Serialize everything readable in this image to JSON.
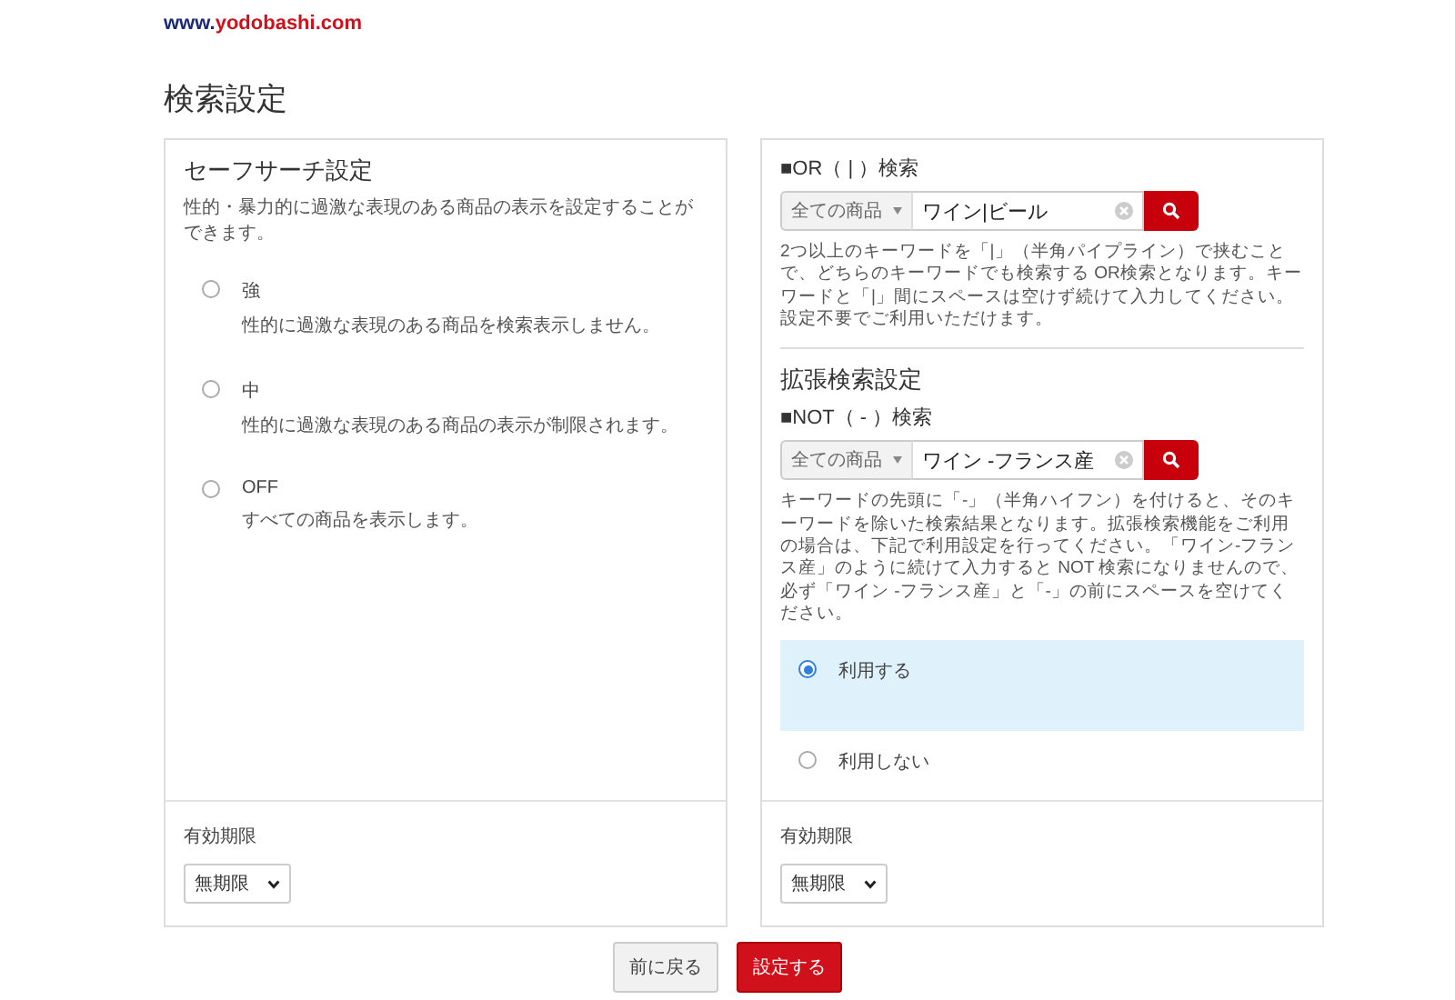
{
  "logo": {
    "prefix": "www.",
    "name": "yodobashi.com"
  },
  "title": "検索設定",
  "safe_search": {
    "heading": "セーフサーチ設定",
    "description": "性的・暴力的に過激な表現のある商品の表示を設定することができます。",
    "options": [
      {
        "label": "強",
        "description": "性的に過激な表現のある商品を検索表示しません。",
        "selected": false
      },
      {
        "label": "中",
        "description": "性的に過激な表現のある商品の表示が制限されます。",
        "selected": false
      },
      {
        "label": "OFF",
        "description": "すべての商品を表示します。",
        "selected": false
      }
    ],
    "expiry": {
      "label": "有効期限",
      "value": "無期限"
    }
  },
  "or_search": {
    "heading": "■OR（ | ）検索",
    "category": "全ての商品",
    "value": "ワイン|ビール",
    "description": "2つ以上のキーワードを「|」（半角パイプライン）で挟むことで、どちらのキーワードでも検索する OR検索となります。キーワードと「|」間にスペースは空けず続けて入力してください。設定不要でご利用いただけます。"
  },
  "extended": {
    "heading": "拡張検索設定",
    "not_heading": "■NOT（ - ）検索",
    "category": "全ての商品",
    "value": "ワイン -フランス産",
    "description": "キーワードの先頭に「-」（半角ハイフン）を付けると、そのキーワードを除いた検索結果となります。拡張検索機能をご利用の場合は、下記で利用設定を行ってください。「ワイン-フランス産」のように続けて入力すると NOT 検索になりませんので、必ず「ワイン -フランス産」と「-」の前にスペースを空けてください。",
    "options": [
      {
        "label": "利用する",
        "selected": true
      },
      {
        "label": "利用しない",
        "selected": false
      }
    ],
    "expiry": {
      "label": "有効期限",
      "value": "無期限"
    }
  },
  "buttons": [
    {
      "kind": "back",
      "label": "前に戻る"
    },
    {
      "kind": "submit",
      "label": "設定する"
    }
  ]
}
